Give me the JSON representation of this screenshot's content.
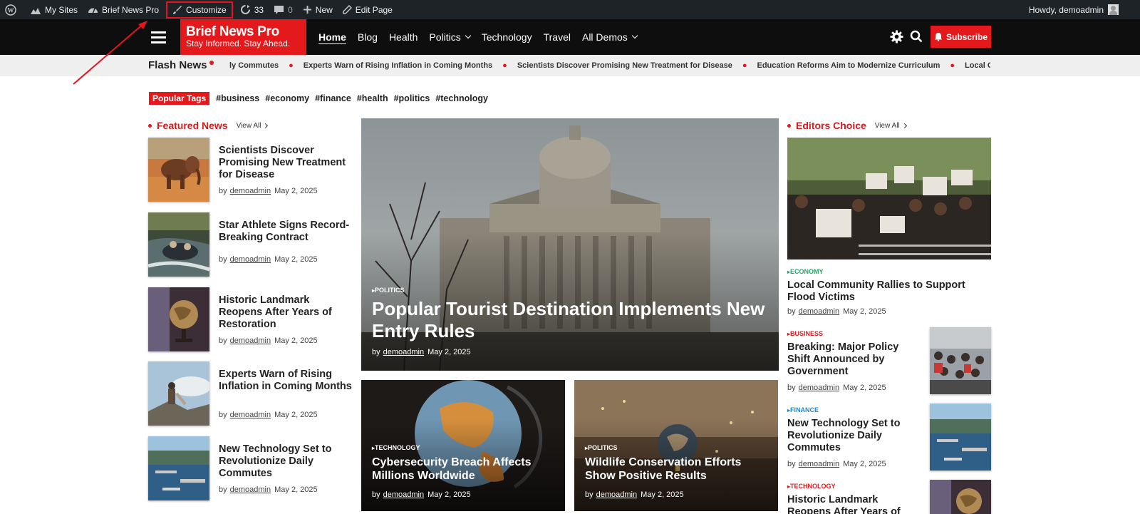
{
  "adminbar": {
    "wp_logo": "wordpress-icon",
    "my_sites": "My Sites",
    "site_name": "Brief News Pro",
    "customize": "Customize",
    "updates_count": "33",
    "comments_count": "0",
    "new": "New",
    "edit_page": "Edit Page",
    "howdy": "Howdy, demoadmin"
  },
  "header": {
    "logo_title": "Brief News Pro",
    "logo_tagline": "Stay Informed. Stay Ahead.",
    "nav": [
      "Home",
      "Blog",
      "Health",
      "Politics",
      "Technology",
      "Travel",
      "All Demos"
    ],
    "subscribe": "Subscribe"
  },
  "flash": {
    "label": "Flash News",
    "items": [
      "ly Commutes",
      "Experts Warn of Rising Inflation in Coming Months",
      "Scientists Discover Promising New Treatment for Disease",
      "Education Reforms Aim to Modernize Curriculum",
      "Local Com"
    ]
  },
  "tags": {
    "label": "Popular Tags",
    "items": [
      "#business",
      "#economy",
      "#finance",
      "#health",
      "#politics",
      "#technology"
    ]
  },
  "featured": {
    "title": "Featured News",
    "view_all": "View All",
    "by": "by",
    "items": [
      {
        "title": "Scientists Discover Promising New Treatment for Disease",
        "author": "demoadmin",
        "date": "May 2, 2025"
      },
      {
        "title": "Star Athlete Signs Record-Breaking Contract",
        "author": "demoadmin",
        "date": "May 2, 2025"
      },
      {
        "title": "Historic Landmark Reopens After Years of Restoration",
        "author": "demoadmin",
        "date": "May 2, 2025"
      },
      {
        "title": "Experts Warn of Rising Inflation in Coming Months",
        "author": "demoadmin",
        "date": "May 2, 2025"
      },
      {
        "title": "New Technology Set to Revolutionize Daily Commutes",
        "author": "demoadmin",
        "date": "May 2, 2025"
      }
    ]
  },
  "hero": {
    "category": "Politics",
    "title": "Popular Tourist Destination Implements New Entry Rules",
    "author": "demoadmin",
    "date": "May 2, 2025"
  },
  "cards": [
    {
      "category": "Technology",
      "title": "Cybersecurity Breach Affects Millions Worldwide",
      "author": "demoadmin",
      "date": "May 2, 2025"
    },
    {
      "category": "Politics",
      "title": "Wildlife Conservation Efforts Show Positive Results",
      "author": "demoadmin",
      "date": "May 2, 2025"
    }
  ],
  "editors": {
    "title": "Editors Choice",
    "view_all": "View All",
    "main": {
      "category": "Economy",
      "title": "Local Community Rallies to Support Flood Victims",
      "author": "demoadmin",
      "date": "May 2, 2025"
    },
    "items": [
      {
        "category": "Business",
        "title": "Breaking: Major Policy Shift Announced by Government",
        "author": "demoadmin",
        "date": "May 2, 2025"
      },
      {
        "category": "Finance",
        "title": "New Technology Set to Revolutionize Daily Commutes",
        "author": "demoadmin",
        "date": "May 2, 2025"
      },
      {
        "category": "Technology",
        "title": "Historic Landmark Reopens After Years of",
        "author": "",
        "date": ""
      }
    ]
  },
  "colors": {
    "brand_red": "#e3191c",
    "header_bg": "#0e0e0e",
    "adminbar_bg": "#1d2327",
    "economy": "#2aa56a",
    "finance": "#1e8ad6"
  }
}
